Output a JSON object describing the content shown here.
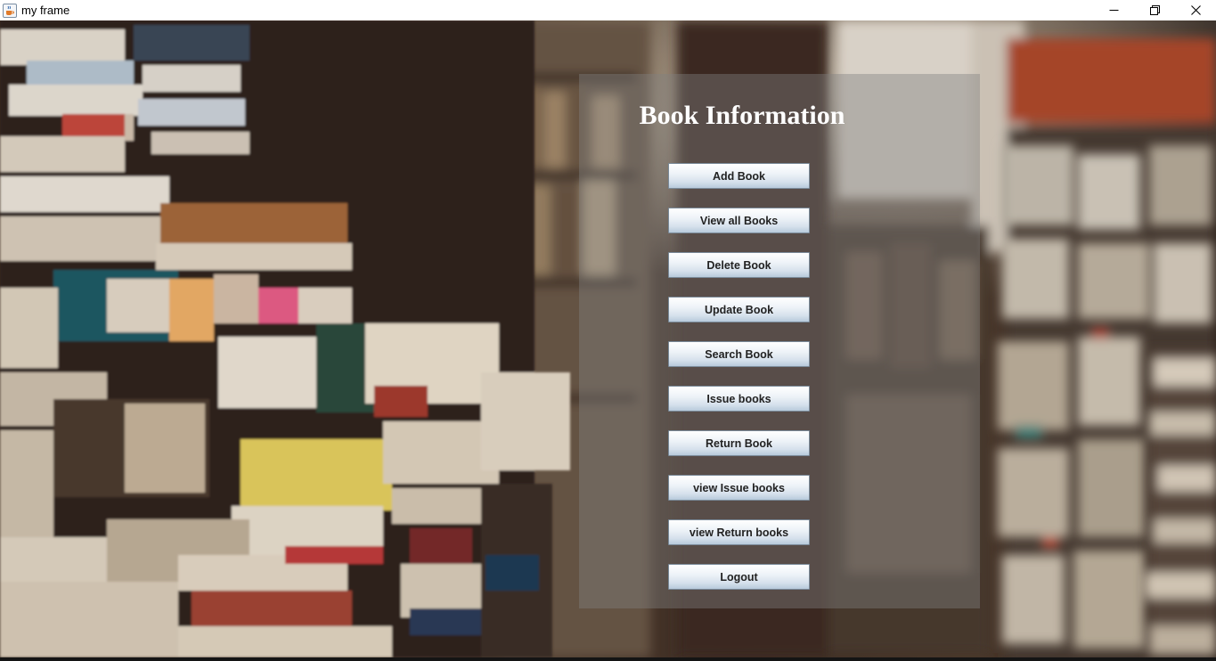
{
  "window": {
    "title": "my frame",
    "app_icon": "java-coffee-icon",
    "controls": [
      "minimize-icon",
      "maximize-icon",
      "close-icon"
    ]
  },
  "background": {
    "description_icon": "library-bookshelves-photo"
  },
  "panel": {
    "title": "Book Information",
    "buttons": [
      {
        "id": "add-book",
        "label": "Add Book"
      },
      {
        "id": "view-all-books",
        "label": "View all Books"
      },
      {
        "id": "delete-book",
        "label": "Delete Book"
      },
      {
        "id": "update-book",
        "label": "Update Book"
      },
      {
        "id": "search-book",
        "label": "Search Book"
      },
      {
        "id": "issue-books",
        "label": "Issue books"
      },
      {
        "id": "return-book",
        "label": "Return Book"
      },
      {
        "id": "view-issue-books",
        "label": "view Issue books"
      },
      {
        "id": "view-return-books",
        "label": "view Return books"
      },
      {
        "id": "logout",
        "label": "Logout"
      }
    ]
  },
  "colors": {
    "titlebar": "#ffffff",
    "panel_overlay": "rgba(128,128,128,0.42)",
    "title_text": "#ffffff",
    "button_gradient_top": "#ffffff",
    "button_gradient_bottom": "#b8cadb"
  }
}
